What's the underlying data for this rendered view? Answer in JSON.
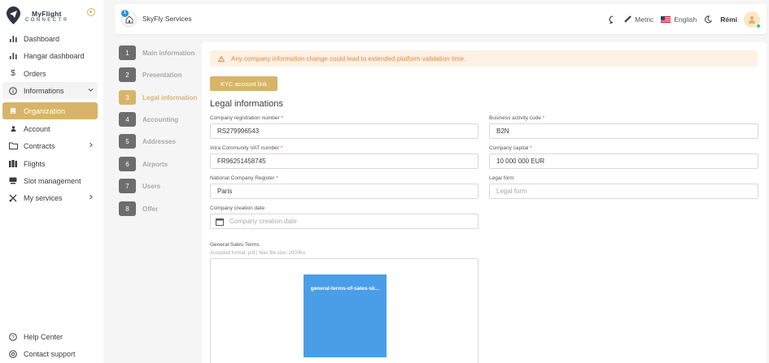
{
  "brand": {
    "line1": "MyFlight",
    "line2": "CONNECT",
    "trademark": "®"
  },
  "sidebar": {
    "items": [
      {
        "label": "Dashboard",
        "icon": "bar-chart-icon"
      },
      {
        "label": "Hangar dashboard",
        "icon": "bar-chart-icon"
      },
      {
        "label": "Orders",
        "icon": "dollar-icon"
      },
      {
        "label": "Informations",
        "icon": "info-icon"
      },
      {
        "label": "Organization",
        "icon": "building-icon"
      },
      {
        "label": "Account",
        "icon": "user-icon"
      },
      {
        "label": "Contracts",
        "icon": "folder-icon"
      },
      {
        "label": "Flights",
        "icon": "flights-icon"
      },
      {
        "label": "Slot management",
        "icon": "slot-icon"
      },
      {
        "label": "My services",
        "icon": "services-icon"
      }
    ],
    "footer": [
      {
        "label": "Help Center",
        "icon": "help-icon"
      },
      {
        "label": "Contact support",
        "icon": "support-icon"
      }
    ]
  },
  "topbar": {
    "notification_count": "1",
    "company": "SkyFly Services",
    "units": "Metric",
    "language": "English",
    "user": "Rémi"
  },
  "steps": [
    {
      "num": "1",
      "label": "Main information"
    },
    {
      "num": "2",
      "label": "Presentation"
    },
    {
      "num": "3",
      "label": "Legal information"
    },
    {
      "num": "4",
      "label": "Accounting"
    },
    {
      "num": "5",
      "label": "Addresses"
    },
    {
      "num": "6",
      "label": "Airports"
    },
    {
      "num": "7",
      "label": "Users"
    },
    {
      "num": "8",
      "label": "Offer"
    }
  ],
  "main": {
    "alert": "Any company information change could lead to extended platform validation time.",
    "kyc_button": "KYC account link",
    "section_title": "Legal informations",
    "fields": {
      "registration": {
        "label": "Company registration number",
        "value": "RS279996543"
      },
      "activity_code": {
        "label": "Business activity code",
        "value": "B2N"
      },
      "vat": {
        "label": "Intra Community VAT number",
        "value": "FR96251458745"
      },
      "capital": {
        "label": "Company capital",
        "value": "10 000 000 EUR"
      },
      "register": {
        "label": "National Company Register",
        "value": "Paris"
      },
      "legal_form": {
        "label": "Legal form",
        "placeholder": "Legal form"
      },
      "creation_date": {
        "label": "Company creation date",
        "placeholder": "Company creation date"
      }
    },
    "required_mark": "*",
    "terms": {
      "title": "General Sales Terms",
      "subtitle": "Accepted format: pdf | Max file size: 2000Ko",
      "file_name": "general-terms-of-sales-sk..."
    }
  },
  "colors": {
    "accent": "#d8b468",
    "file": "#4a9ee8",
    "alert_text": "#e58d3a",
    "alert_bg": "#fdf0e4"
  }
}
